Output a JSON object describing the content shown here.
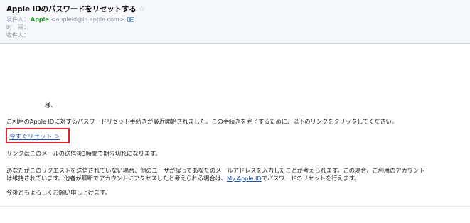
{
  "email": {
    "subject": "Apple IDのパスワードをリセットする",
    "sender_label": "发件人：",
    "sender_name": "Apple",
    "sender_email": "<appleid@id.apple.com>",
    "time_label": "时　间：",
    "recipient_label": "收件人："
  },
  "body": {
    "greeting": "様、",
    "intro": "ご利用のApple IDに対するパスワードリセット手続きが最近開始されました。この手続きを完了するために、以下のリンクをクリックしてください。",
    "reset_link": "今すぐリセット ＞",
    "expiry": "リンクはこのメールの送信後3時間で期限切れになります。",
    "para_line1": "あなたがこのリクエストを送信されていない場合、他のユーザが誤ってあなたのメールアドレスを入力したことが考えられます。この場合、ご利用のアカウント",
    "para_line2_pre": "は維持されています。他者が無断でアカウントにアクセスしたと考えられる場合は、",
    "para_link": "My Apple ID",
    "para_line2_post": "でパスワードのリセットを行えます。",
    "closing": "今後ともよろしくお願い申し上げます。"
  }
}
